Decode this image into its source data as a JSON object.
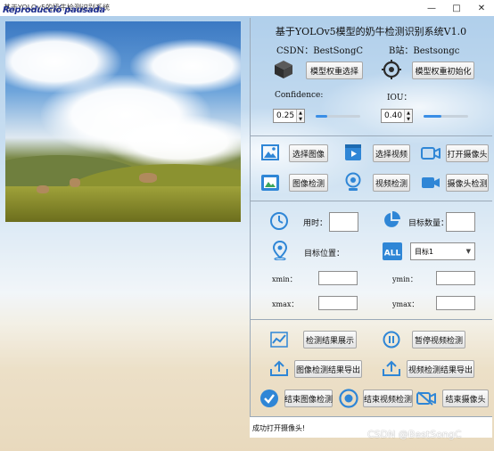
{
  "window": {
    "title": "基于YOLOv5的奶牛检测识别系统",
    "overlay_title": "Reproducció pausada",
    "controls": [
      "—",
      "□",
      "✕"
    ]
  },
  "header": {
    "title": "基于YOLOv5模型的奶牛检测识别系统V1.0",
    "csdn": "CSDN：BestSongC",
    "bilibili": "B站：Bestsongc"
  },
  "model": {
    "select_label": "模型权重选择",
    "init_label": "模型权重初始化"
  },
  "params": {
    "confidence_label": "Confidence:",
    "confidence_value": "0.25",
    "confidence_level": 0.25,
    "iou_label": "IOU：",
    "iou_value": "0.40",
    "iou_level": 0.4
  },
  "inputs": {
    "select_image": "选择图像",
    "select_video": "选择视频",
    "open_camera": "打开摄像头",
    "image_detect": "图像检测",
    "video_detect": "视频检测",
    "camera_detect": "摄像头检测"
  },
  "stats": {
    "time_label": "用时：",
    "time_value": "",
    "count_label": "目标数量：",
    "count_value": "",
    "position_label": "目标位置：",
    "target_select": "目标1",
    "xmin_label": "xmin：",
    "ymin_label": "ymin：",
    "xmax_label": "xmax：",
    "ymax_label": "ymax：",
    "xmin_value": "",
    "ymin_value": "",
    "xmax_value": "",
    "ymax_value": ""
  },
  "actions": {
    "show_results": "检测结果展示",
    "pause_video": "暂停视频检测",
    "export_image": "图像检测结果导出",
    "export_video": "视频检测结果导出",
    "end_image": "结束图像检测",
    "end_video": "结束视频检测",
    "end_camera": "结束摄像头"
  },
  "status": {
    "message": "成功打开摄像头!"
  },
  "watermark": "CSDN @BestSongC",
  "colors": {
    "accent": "#3a8ee6",
    "icon_blue": "#2f86d6",
    "cube": "#3c3c3c"
  }
}
